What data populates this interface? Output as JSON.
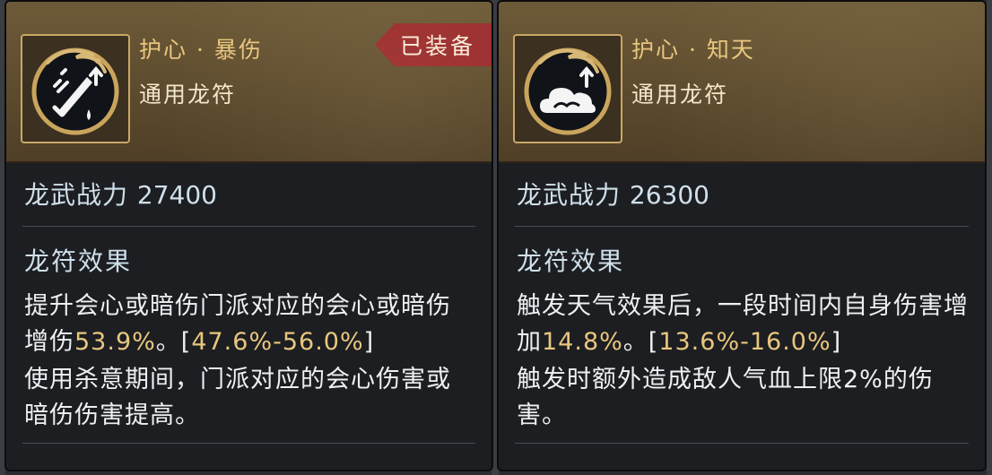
{
  "cards": [
    {
      "name": "护心 · 暴伤",
      "type": "通用龙符",
      "equipped_label": "已装备",
      "power_label": "龙武战力",
      "power_value": "27400",
      "effect_title": "龙符效果",
      "desc1_a": "提升会心或暗伤门派对应的会心或暗伤增伤",
      "desc1_value": "53.9%",
      "desc1_sep": "。[",
      "desc1_range": "47.6%-56.0%",
      "desc1_end": "]",
      "desc2": "使用杀意期间，门派对应的会心伤害或暗伤伤害提高。",
      "icon": "sword-crit-icon"
    },
    {
      "name": "护心 · 知天",
      "type": "通用龙符",
      "power_label": "龙武战力",
      "power_value": "26300",
      "effect_title": "龙符效果",
      "desc1_a": "触发天气效果后，一段时间内自身伤害增加",
      "desc1_value": "14.8%",
      "desc1_sep": "。[",
      "desc1_range": "13.6%-16.0%",
      "desc1_end": "]",
      "desc2": "触发时额外造成敌人气血上限2%的伤害。",
      "icon": "cloud-weather-icon"
    }
  ],
  "colors": {
    "gold": "#e8c67e",
    "equipped_badge": "#9a2a2d",
    "card_bg": "#1d1e22",
    "header_bg": "#5d4b2e"
  }
}
